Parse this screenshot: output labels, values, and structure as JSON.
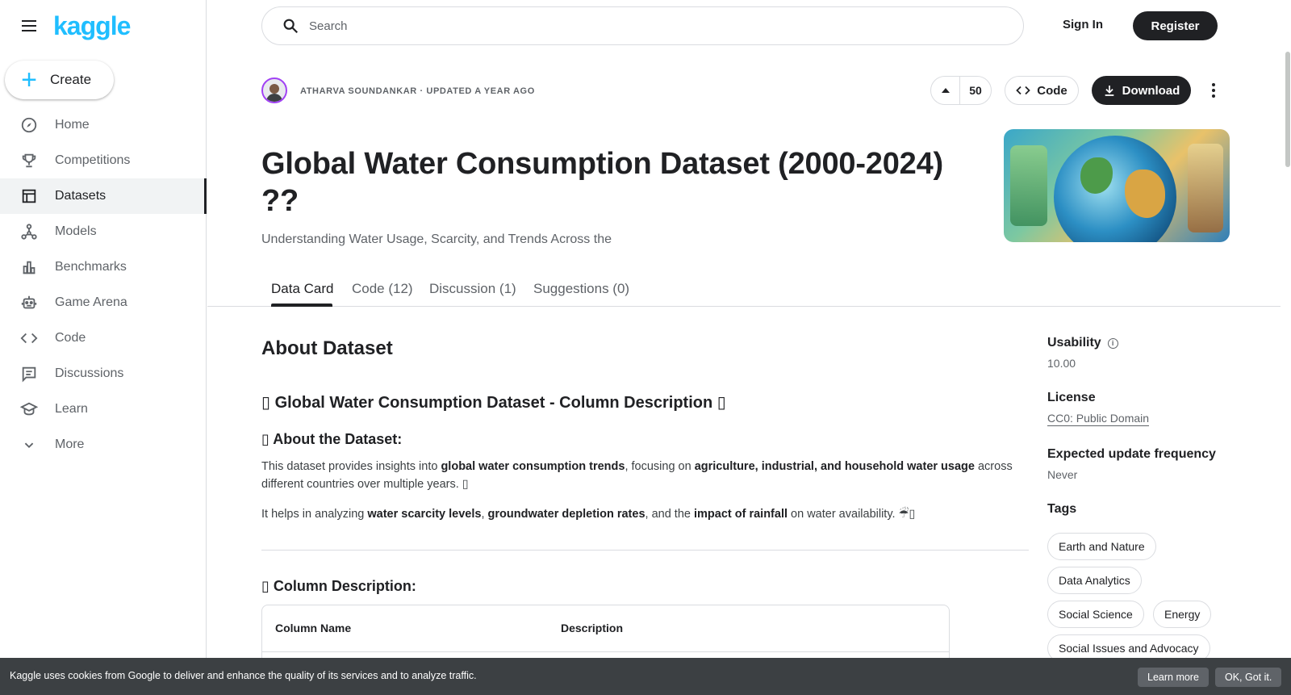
{
  "sidebar": {
    "logo": "kaggle",
    "create_label": "Create",
    "items": [
      {
        "label": "Home",
        "icon": "compass-icon"
      },
      {
        "label": "Competitions",
        "icon": "trophy-icon"
      },
      {
        "label": "Datasets",
        "icon": "table-icon",
        "active": true
      },
      {
        "label": "Models",
        "icon": "models-icon"
      },
      {
        "label": "Benchmarks",
        "icon": "bar-chart-icon"
      },
      {
        "label": "Game Arena",
        "icon": "robot-icon"
      },
      {
        "label": "Code",
        "icon": "code-icon"
      },
      {
        "label": "Discussions",
        "icon": "comment-icon"
      },
      {
        "label": "Learn",
        "icon": "school-icon"
      },
      {
        "label": "More",
        "icon": "chevron-down-icon"
      }
    ]
  },
  "topbar": {
    "search_placeholder": "Search",
    "sign_in": "Sign In",
    "register": "Register"
  },
  "header": {
    "meta": "ATHARVA SOUNDANKAR · UPDATED A YEAR AGO",
    "votes": "50",
    "code_label": "Code",
    "download_label": "Download",
    "title": "Global Water Consumption Dataset (2000-2024) ??",
    "subtitle": "Understanding Water Usage, Scarcity, and Trends Across the"
  },
  "tabs": [
    "Data Card",
    "Code (12)",
    "Discussion (1)",
    "Suggestions (0)"
  ],
  "content": {
    "about_title": "About Dataset",
    "h2": "▯ Global Water Consumption Dataset - Column Description ▯",
    "h3_about": "▯ About the Dataset:",
    "p1": {
      "t1": "This dataset provides insights into ",
      "b1": "global water consumption trends",
      "t2": ", focusing on ",
      "b2": "agriculture, industrial, and household water usage",
      "t3": " across different countries over multiple years. ▯"
    },
    "p2": {
      "t1": "It helps in analyzing ",
      "b1": "water scarcity levels",
      "t2": ", ",
      "b2": "groundwater depletion rates",
      "t3": ", and the ",
      "b3": "impact of rainfall",
      "t4": " on water availability. ☔▯"
    },
    "h3_columns": "▯ Column Description:",
    "table_headers": [
      "Column Name",
      "Description"
    ]
  },
  "side": {
    "usability_label": "Usability",
    "usability_value": "10.00",
    "license_label": "License",
    "license_value": "CC0: Public Domain",
    "frequency_label": "Expected update frequency",
    "frequency_value": "Never",
    "tags_label": "Tags",
    "tags": [
      "Earth and Nature",
      "Data Analytics",
      "Social Science",
      "Energy",
      "Social Issues and Advocacy"
    ]
  },
  "cookie": {
    "text": "Kaggle uses cookies from Google to deliver and enhance the quality of its services and to analyze traffic.",
    "learn_more": "Learn more",
    "ok": "OK, Got it."
  }
}
